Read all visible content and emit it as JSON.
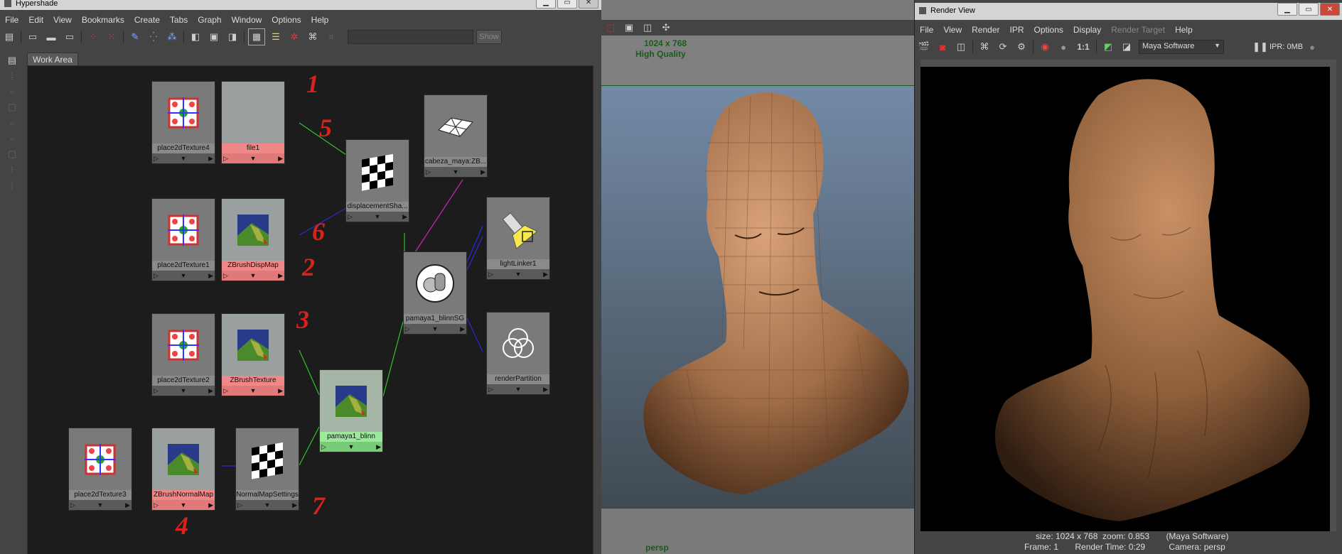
{
  "hypershade": {
    "title": "Hypershade",
    "menus": [
      "File",
      "Edit",
      "View",
      "Bookmarks",
      "Create",
      "Tabs",
      "Graph",
      "Window",
      "Options",
      "Help"
    ],
    "show_button": "Show",
    "tab": "Work Area",
    "nodes": {
      "place2dTexture4": "place2dTexture4",
      "file1": "file1",
      "displacementShader": "displacementSha...",
      "cabeza": "cabeza_maya:ZB...",
      "place2dTexture1": "place2dTexture1",
      "ZBrushDispMap": "ZBrushDispMap",
      "lightLinker1": "lightLinker1",
      "pamaya1_blinnSG": "pamaya1_blinnSG",
      "place2dTexture2": "place2dTexture2",
      "ZBrushTexture": "ZBrushTexture",
      "renderPartition": "renderPartition",
      "pamaya1_blinn": "pamaya1_blinn",
      "place2dTexture3": "place2dTexture3",
      "ZBrushNormalMap": "ZBrushNormalMap",
      "NormalMapSettings": "NormalMapSettings"
    },
    "annotations": [
      "1",
      "5",
      "6",
      "2",
      "3",
      "7",
      "4"
    ]
  },
  "viewport": {
    "resolution": "1024 x 768",
    "quality": "High Quality",
    "camera": "persp"
  },
  "render_view": {
    "title": "Render View",
    "menus": [
      "File",
      "View",
      "Render",
      "IPR",
      "Options",
      "Display",
      "Render Target",
      "Help"
    ],
    "renderer": "Maya Software",
    "ratio": "1:1",
    "ipr": "IPR: 0MB",
    "status_line1": "size: 1024 x 768  zoom: 0.853       (Maya Software)",
    "status_line2": "Frame: 1       Render Time: 0:29          Camera: persp"
  },
  "colors": {
    "accent_green": "#2d7a2d",
    "node_pink": "#f08888",
    "node_green": "#9ee89e",
    "annotation_red": "#d8221c"
  }
}
